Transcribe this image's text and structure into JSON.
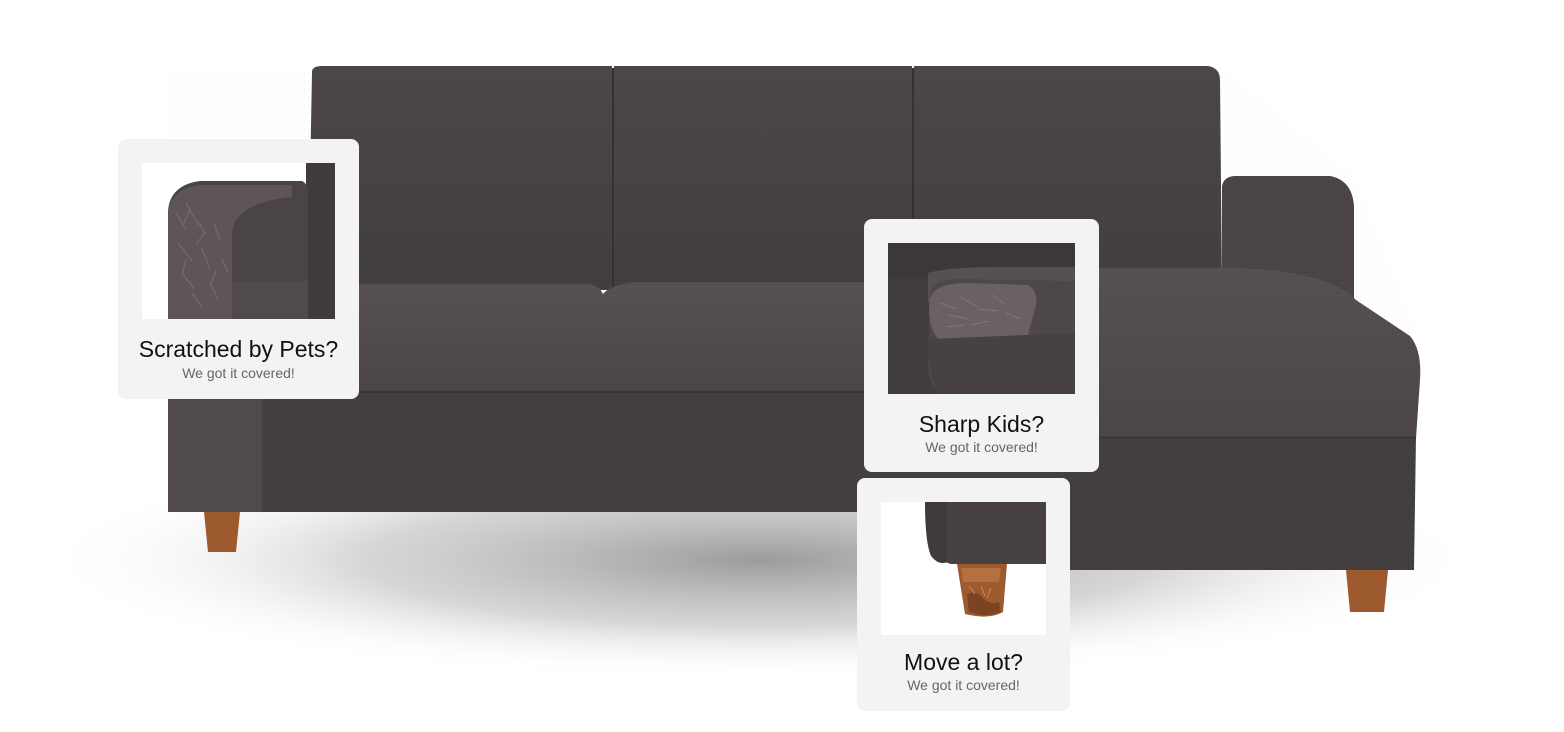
{
  "cards": [
    {
      "title": "Scratched by Pets?",
      "subtitle": "We got it covered!",
      "thumb_icon": "scratched-armrest-closeup"
    },
    {
      "title": "Sharp Kids?",
      "subtitle": "We got it covered!",
      "thumb_icon": "torn-cushion-closeup"
    },
    {
      "title": "Move a lot?",
      "subtitle": "We got it covered!",
      "thumb_icon": "damaged-leg-closeup"
    }
  ],
  "colors": {
    "fabric": "#4a4446",
    "fabric_dark": "#3e393b",
    "fabric_light": "#585153",
    "wood_leg": "#9c5a2e",
    "card_bg": "#f3f3f3",
    "title_text": "#111111",
    "subtitle_text": "#666666"
  }
}
